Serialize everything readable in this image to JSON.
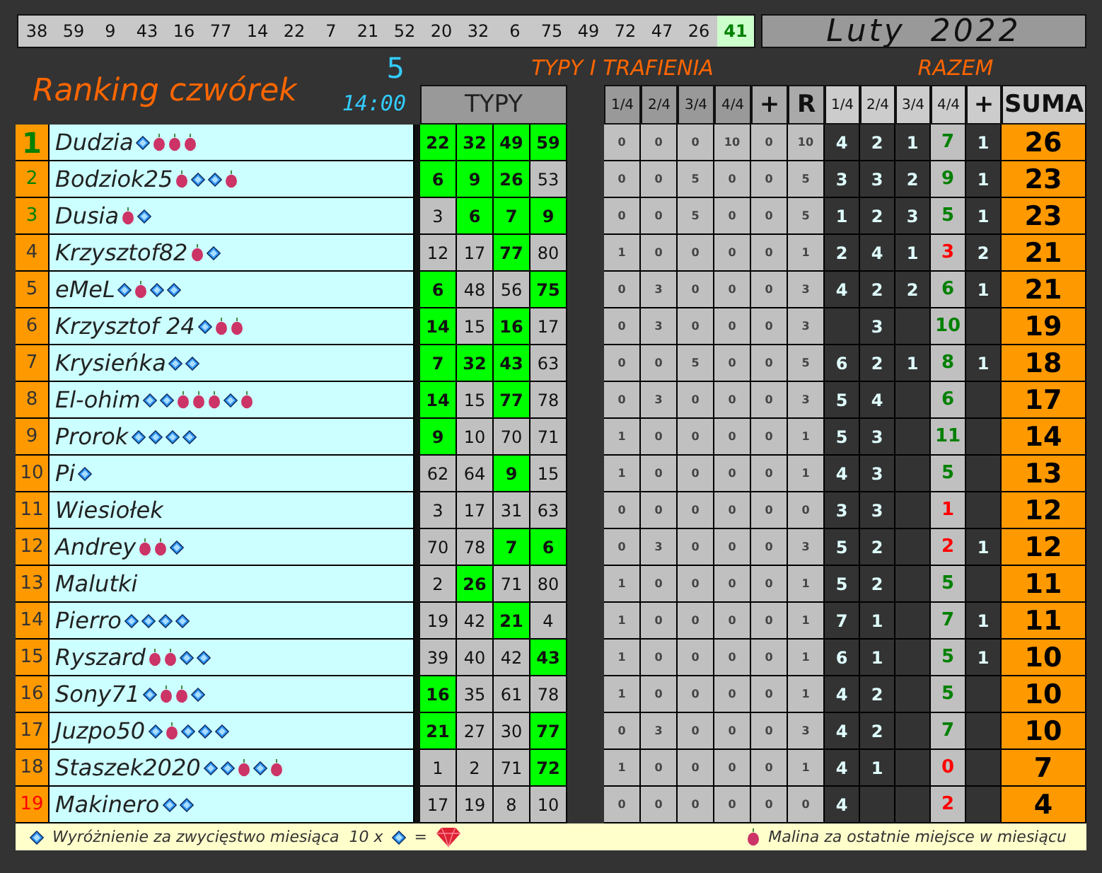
{
  "drawn_numbers": [
    {
      "value": "38",
      "highlighted": false
    },
    {
      "value": "59",
      "highlighted": false
    },
    {
      "value": "9",
      "highlighted": false
    },
    {
      "value": "43",
      "highlighted": false
    },
    {
      "value": "16",
      "highlighted": false
    },
    {
      "value": "77",
      "highlighted": false
    },
    {
      "value": "14",
      "highlighted": false
    },
    {
      "value": "22",
      "highlighted": false
    },
    {
      "value": "7",
      "highlighted": false
    },
    {
      "value": "21",
      "highlighted": false
    },
    {
      "value": "52",
      "highlighted": false
    },
    {
      "value": "20",
      "highlighted": false
    },
    {
      "value": "32",
      "highlighted": false
    },
    {
      "value": "6",
      "highlighted": false
    },
    {
      "value": "75",
      "highlighted": false
    },
    {
      "value": "49",
      "highlighted": false
    },
    {
      "value": "72",
      "highlighted": false
    },
    {
      "value": "47",
      "highlighted": false
    },
    {
      "value": "26",
      "highlighted": false
    },
    {
      "value": "41",
      "highlighted": true
    }
  ],
  "month_title": "Luty  2022",
  "ranking_title": "Ranking czwórek",
  "round": "5",
  "time": "14:00",
  "section_tips": "TYPY I TRAFIENIA",
  "section_total": "RAZEM",
  "tips_header": "TYPY",
  "stats_columns": [
    "1/4",
    "2/4",
    "3/4",
    "4/4",
    "+",
    "R"
  ],
  "total_columns": [
    "1/4",
    "2/4",
    "3/4",
    "4/4",
    "+",
    "SUMA"
  ],
  "rows": [
    {
      "rank": "1",
      "podium": true,
      "last": false,
      "name": "Dudzia",
      "badges": [
        {
          "kind": "diamond"
        },
        {
          "kind": "raspberry"
        },
        {
          "kind": "raspberry"
        },
        {
          "kind": "raspberry"
        }
      ],
      "typy": [
        {
          "value": "22",
          "hit": true
        },
        {
          "value": "32",
          "hit": true
        },
        {
          "value": "49",
          "hit": true
        },
        {
          "value": "59",
          "hit": true
        }
      ],
      "stats": [
        "0",
        "0",
        "0",
        "10",
        "0",
        "10"
      ],
      "razem": {
        "q1": "4",
        "q2": "2",
        "q3": "1",
        "q4": "7",
        "plus": "1",
        "q4_low": false
      },
      "suma": "26"
    },
    {
      "rank": "2",
      "podium": true,
      "last": false,
      "name": "Bodziok25",
      "badges": [
        {
          "kind": "raspberry"
        },
        {
          "kind": "diamond"
        },
        {
          "kind": "diamond"
        },
        {
          "kind": "raspberry"
        }
      ],
      "typy": [
        {
          "value": "6",
          "hit": true
        },
        {
          "value": "9",
          "hit": true
        },
        {
          "value": "26",
          "hit": true
        },
        {
          "value": "53",
          "hit": false
        }
      ],
      "stats": [
        "0",
        "0",
        "5",
        "0",
        "0",
        "5"
      ],
      "razem": {
        "q1": "3",
        "q2": "3",
        "q3": "2",
        "q4": "9",
        "plus": "1",
        "q4_low": false
      },
      "suma": "23"
    },
    {
      "rank": "3",
      "podium": true,
      "last": false,
      "name": "Dusia",
      "badges": [
        {
          "kind": "raspberry"
        },
        {
          "kind": "diamond"
        }
      ],
      "typy": [
        {
          "value": "3",
          "hit": false
        },
        {
          "value": "6",
          "hit": true
        },
        {
          "value": "7",
          "hit": true
        },
        {
          "value": "9",
          "hit": true
        }
      ],
      "stats": [
        "0",
        "0",
        "5",
        "0",
        "0",
        "5"
      ],
      "razem": {
        "q1": "1",
        "q2": "2",
        "q3": "3",
        "q4": "5",
        "plus": "1",
        "q4_low": false
      },
      "suma": "23"
    },
    {
      "rank": "4",
      "podium": false,
      "last": false,
      "name": "Krzysztof82",
      "badges": [
        {
          "kind": "raspberry"
        },
        {
          "kind": "diamond"
        }
      ],
      "typy": [
        {
          "value": "12",
          "hit": false
        },
        {
          "value": "17",
          "hit": false
        },
        {
          "value": "77",
          "hit": true
        },
        {
          "value": "80",
          "hit": false
        }
      ],
      "stats": [
        "1",
        "0",
        "0",
        "0",
        "0",
        "1"
      ],
      "razem": {
        "q1": "2",
        "q2": "4",
        "q3": "1",
        "q4": "3",
        "plus": "2",
        "q4_low": true
      },
      "suma": "21"
    },
    {
      "rank": "5",
      "podium": false,
      "last": false,
      "name": "eMeL",
      "badges": [
        {
          "kind": "diamond"
        },
        {
          "kind": "raspberry"
        },
        {
          "kind": "diamond"
        },
        {
          "kind": "diamond"
        }
      ],
      "typy": [
        {
          "value": "6",
          "hit": true
        },
        {
          "value": "48",
          "hit": false
        },
        {
          "value": "56",
          "hit": false
        },
        {
          "value": "75",
          "hit": true
        }
      ],
      "stats": [
        "0",
        "3",
        "0",
        "0",
        "0",
        "3"
      ],
      "razem": {
        "q1": "4",
        "q2": "2",
        "q3": "2",
        "q4": "6",
        "plus": "1",
        "q4_low": false
      },
      "suma": "21"
    },
    {
      "rank": "6",
      "podium": false,
      "last": false,
      "name": "Krzysztof 24",
      "badges": [
        {
          "kind": "diamond"
        },
        {
          "kind": "raspberry"
        },
        {
          "kind": "raspberry"
        }
      ],
      "typy": [
        {
          "value": "14",
          "hit": true
        },
        {
          "value": "15",
          "hit": false
        },
        {
          "value": "16",
          "hit": true
        },
        {
          "value": "17",
          "hit": false
        }
      ],
      "stats": [
        "0",
        "3",
        "0",
        "0",
        "0",
        "3"
      ],
      "razem": {
        "q2": "3",
        "q4": "10",
        "q4_low": false
      },
      "suma": "19"
    },
    {
      "rank": "7",
      "podium": false,
      "last": false,
      "name": "Krysieńka",
      "badges": [
        {
          "kind": "diamond"
        },
        {
          "kind": "diamond"
        }
      ],
      "typy": [
        {
          "value": "7",
          "hit": true
        },
        {
          "value": "32",
          "hit": true
        },
        {
          "value": "43",
          "hit": true
        },
        {
          "value": "63",
          "hit": false
        }
      ],
      "stats": [
        "0",
        "0",
        "5",
        "0",
        "0",
        "5"
      ],
      "razem": {
        "q1": "6",
        "q2": "2",
        "q3": "1",
        "q4": "8",
        "plus": "1",
        "q4_low": false
      },
      "suma": "18"
    },
    {
      "rank": "8",
      "podium": false,
      "last": false,
      "name": "El-ohim",
      "badges": [
        {
          "kind": "diamond"
        },
        {
          "kind": "diamond"
        },
        {
          "kind": "raspberry"
        },
        {
          "kind": "raspberry"
        },
        {
          "kind": "raspberry"
        },
        {
          "kind": "diamond"
        },
        {
          "kind": "raspberry"
        }
      ],
      "typy": [
        {
          "value": "14",
          "hit": true
        },
        {
          "value": "15",
          "hit": false
        },
        {
          "value": "77",
          "hit": true
        },
        {
          "value": "78",
          "hit": false
        }
      ],
      "stats": [
        "0",
        "3",
        "0",
        "0",
        "0",
        "3"
      ],
      "razem": {
        "q1": "5",
        "q2": "4",
        "q4": "6",
        "q4_low": false
      },
      "suma": "17"
    },
    {
      "rank": "9",
      "podium": false,
      "last": false,
      "name": "Prorok",
      "badges": [
        {
          "kind": "diamond"
        },
        {
          "kind": "diamond"
        },
        {
          "kind": "diamond"
        },
        {
          "kind": "diamond"
        }
      ],
      "typy": [
        {
          "value": "9",
          "hit": true
        },
        {
          "value": "10",
          "hit": false
        },
        {
          "value": "70",
          "hit": false
        },
        {
          "value": "71",
          "hit": false
        }
      ],
      "stats": [
        "1",
        "0",
        "0",
        "0",
        "0",
        "1"
      ],
      "razem": {
        "q1": "5",
        "q2": "3",
        "q4": "11",
        "q4_low": false
      },
      "suma": "14"
    },
    {
      "rank": "10",
      "podium": false,
      "last": false,
      "name": "Pi",
      "badges": [
        {
          "kind": "diamond"
        }
      ],
      "typy": [
        {
          "value": "62",
          "hit": false
        },
        {
          "value": "64",
          "hit": false
        },
        {
          "value": "9",
          "hit": true
        },
        {
          "value": "15",
          "hit": false
        }
      ],
      "stats": [
        "1",
        "0",
        "0",
        "0",
        "0",
        "1"
      ],
      "razem": {
        "q1": "4",
        "q2": "3",
        "q4": "5",
        "q4_low": false
      },
      "suma": "13"
    },
    {
      "rank": "11",
      "podium": false,
      "last": false,
      "name": "Wiesiołek",
      "badges": [],
      "typy": [
        {
          "value": "3",
          "hit": false
        },
        {
          "value": "17",
          "hit": false
        },
        {
          "value": "31",
          "hit": false
        },
        {
          "value": "63",
          "hit": false
        }
      ],
      "stats": [
        "0",
        "0",
        "0",
        "0",
        "0",
        "0"
      ],
      "razem": {
        "q1": "3",
        "q2": "3",
        "q4": "1",
        "q4_low": true
      },
      "suma": "12"
    },
    {
      "rank": "12",
      "podium": false,
      "last": false,
      "name": "Andrey",
      "badges": [
        {
          "kind": "raspberry"
        },
        {
          "kind": "raspberry"
        },
        {
          "kind": "diamond"
        }
      ],
      "typy": [
        {
          "value": "70",
          "hit": false
        },
        {
          "value": "78",
          "hit": false
        },
        {
          "value": "7",
          "hit": true
        },
        {
          "value": "6",
          "hit": true
        }
      ],
      "stats": [
        "0",
        "3",
        "0",
        "0",
        "0",
        "3"
      ],
      "razem": {
        "q1": "5",
        "q2": "2",
        "q4": "2",
        "plus": "1",
        "q4_low": true
      },
      "suma": "12"
    },
    {
      "rank": "13",
      "podium": false,
      "last": false,
      "name": "Malutki",
      "badges": [],
      "typy": [
        {
          "value": "2",
          "hit": false
        },
        {
          "value": "26",
          "hit": true
        },
        {
          "value": "71",
          "hit": false
        },
        {
          "value": "80",
          "hit": false
        }
      ],
      "stats": [
        "1",
        "0",
        "0",
        "0",
        "0",
        "1"
      ],
      "razem": {
        "q1": "5",
        "q2": "2",
        "q4": "5",
        "q4_low": false
      },
      "suma": "11"
    },
    {
      "rank": "14",
      "podium": false,
      "last": false,
      "name": "Pierro",
      "badges": [
        {
          "kind": "diamond"
        },
        {
          "kind": "diamond"
        },
        {
          "kind": "diamond"
        },
        {
          "kind": "diamond"
        }
      ],
      "typy": [
        {
          "value": "19",
          "hit": false
        },
        {
          "value": "42",
          "hit": false
        },
        {
          "value": "21",
          "hit": true
        },
        {
          "value": "4",
          "hit": false
        }
      ],
      "stats": [
        "1",
        "0",
        "0",
        "0",
        "0",
        "1"
      ],
      "razem": {
        "q1": "7",
        "q2": "1",
        "q4": "7",
        "plus": "1",
        "q4_low": false
      },
      "suma": "11"
    },
    {
      "rank": "15",
      "podium": false,
      "last": false,
      "name": "Ryszard",
      "badges": [
        {
          "kind": "raspberry"
        },
        {
          "kind": "raspberry"
        },
        {
          "kind": "diamond"
        },
        {
          "kind": "diamond"
        }
      ],
      "typy": [
        {
          "value": "39",
          "hit": false
        },
        {
          "value": "40",
          "hit": false
        },
        {
          "value": "42",
          "hit": false
        },
        {
          "value": "43",
          "hit": true
        }
      ],
      "stats": [
        "1",
        "0",
        "0",
        "0",
        "0",
        "1"
      ],
      "razem": {
        "q1": "6",
        "q2": "1",
        "q4": "5",
        "plus": "1",
        "q4_low": false
      },
      "suma": "10"
    },
    {
      "rank": "16",
      "podium": false,
      "last": false,
      "name": "Sony71",
      "badges": [
        {
          "kind": "diamond"
        },
        {
          "kind": "raspberry"
        },
        {
          "kind": "raspberry"
        },
        {
          "kind": "diamond"
        }
      ],
      "typy": [
        {
          "value": "16",
          "hit": true
        },
        {
          "value": "35",
          "hit": false
        },
        {
          "value": "61",
          "hit": false
        },
        {
          "value": "78",
          "hit": false
        }
      ],
      "stats": [
        "1",
        "0",
        "0",
        "0",
        "0",
        "1"
      ],
      "razem": {
        "q1": "4",
        "q2": "2",
        "q4": "5",
        "q4_low": false
      },
      "suma": "10"
    },
    {
      "rank": "17",
      "podium": false,
      "last": false,
      "name": "Juzpo50",
      "badges": [
        {
          "kind": "diamond"
        },
        {
          "kind": "raspberry"
        },
        {
          "kind": "diamond"
        },
        {
          "kind": "diamond"
        },
        {
          "kind": "diamond"
        }
      ],
      "typy": [
        {
          "value": "21",
          "hit": true
        },
        {
          "value": "27",
          "hit": false
        },
        {
          "value": "30",
          "hit": false
        },
        {
          "value": "77",
          "hit": true
        }
      ],
      "stats": [
        "0",
        "3",
        "0",
        "0",
        "0",
        "3"
      ],
      "razem": {
        "q1": "4",
        "q2": "2",
        "q4": "7",
        "q4_low": false
      },
      "suma": "10"
    },
    {
      "rank": "18",
      "podium": false,
      "last": false,
      "name": "Staszek2020",
      "badges": [
        {
          "kind": "diamond"
        },
        {
          "kind": "diamond"
        },
        {
          "kind": "raspberry"
        },
        {
          "kind": "diamond"
        },
        {
          "kind": "raspberry"
        }
      ],
      "typy": [
        {
          "value": "1",
          "hit": false
        },
        {
          "value": "2",
          "hit": false
        },
        {
          "value": "71",
          "hit": false
        },
        {
          "value": "72",
          "hit": true
        }
      ],
      "stats": [
        "1",
        "0",
        "0",
        "0",
        "0",
        "1"
      ],
      "razem": {
        "q1": "4",
        "q2": "1",
        "q4": "0",
        "q4_low": true
      },
      "suma": "7"
    },
    {
      "rank": "19",
      "podium": false,
      "last": true,
      "name": "Makinero",
      "badges": [
        {
          "kind": "diamond"
        },
        {
          "kind": "diamond"
        }
      ],
      "typy": [
        {
          "value": "17",
          "hit": false
        },
        {
          "value": "19",
          "hit": false
        },
        {
          "value": "8",
          "hit": false
        },
        {
          "value": "10",
          "hit": false
        }
      ],
      "stats": [
        "0",
        "0",
        "0",
        "0",
        "0",
        "0"
      ],
      "razem": {
        "q1": "4",
        "q4": "2",
        "q4_low": true
      },
      "suma": "4"
    }
  ],
  "legend": {
    "award_text": "Wyróżnienie za zwycięstwo miesiąca  10 x",
    "equals": "=",
    "raspberry_text": "Malina za ostatnie miejsce w miesiącu"
  }
}
